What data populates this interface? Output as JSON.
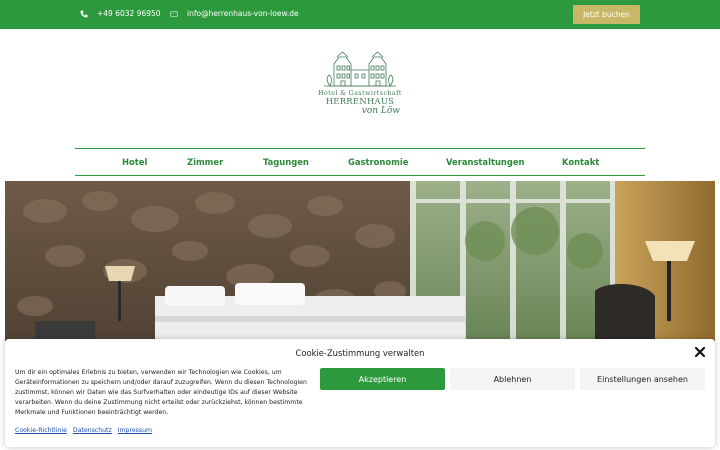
{
  "topbar": {
    "phone": "+49 6032 96950",
    "email": "info@herrenhaus-von-loew.de",
    "phone_icon": "phone-icon",
    "email_icon": "envelope-icon",
    "book_label": "Jetzt buchen",
    "bg_color": "#2c9a3c",
    "button_color": "#c7b766"
  },
  "logo": {
    "line1": "Hotel & Gastwirtschaft",
    "line2": "HERRENHAUS",
    "line3": "von Löw"
  },
  "nav": {
    "items": [
      "Hotel",
      "Zimmer",
      "Tagungen",
      "Gastronomie",
      "Veranstaltungen",
      "Kontakt"
    ]
  },
  "cookie": {
    "title": "Cookie-Zustimmung verwalten",
    "body": "Um dir ein optimales Erlebnis zu bieten, verwenden wir Technologien wie Cookies, um Geräteinformationen zu speichern und/oder darauf zuzugreifen. Wenn du diesen Technologien zustimmst, können wir Daten wie das Surfverhalten oder eindeutige IDs auf dieser Website verarbeiten. Wenn du deine Zustimmung nicht erteilst oder zurückziehst, können bestimmte Merkmale und Funktionen beeinträchtigt werden.",
    "accept": "Akzeptieren",
    "deny": "Ablehnen",
    "settings": "Einstellungen ansehen",
    "links": [
      "Cookie-Richtlinie",
      "Datenschutz",
      "Impressum"
    ],
    "accent_color": "#2c9a3c"
  }
}
